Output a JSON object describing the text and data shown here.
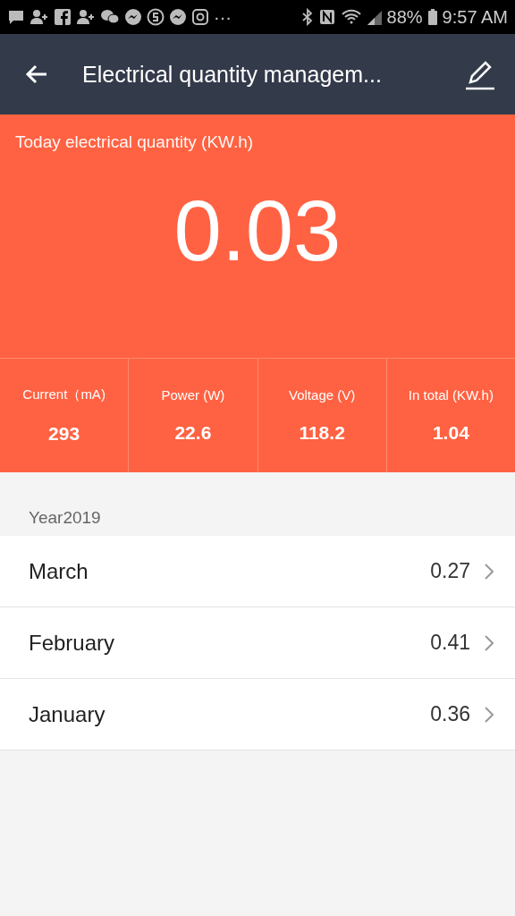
{
  "status_bar": {
    "overflow": "···",
    "battery": "88%",
    "time": "9:57 AM"
  },
  "app_bar": {
    "title": "Electrical quantity managem..."
  },
  "today": {
    "label": "Today electrical quantity (KW.h)",
    "value": "0.03"
  },
  "stats": [
    {
      "label": "Current（mA)",
      "value": "293"
    },
    {
      "label": "Power (W)",
      "value": "22.6"
    },
    {
      "label": "Voltage (V)",
      "value": "118.2"
    },
    {
      "label": "In total (KW.h)",
      "value": "1.04"
    }
  ],
  "year": {
    "label": "Year2019",
    "months": [
      {
        "name": "March",
        "value": "0.27"
      },
      {
        "name": "February",
        "value": "0.41"
      },
      {
        "name": "January",
        "value": "0.36"
      }
    ]
  }
}
